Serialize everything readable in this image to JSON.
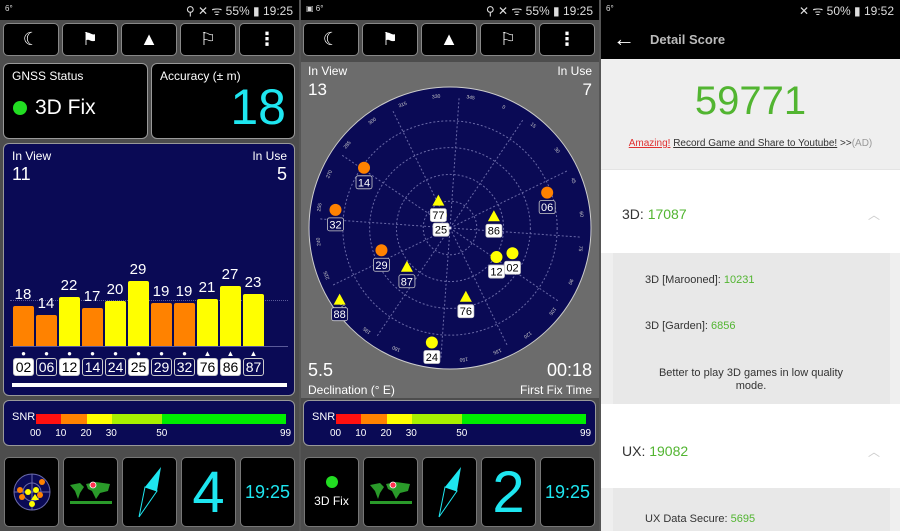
{
  "colors": {
    "navy": "#0a0a55",
    "orange": "#ff8200",
    "yellow": "#ffff00",
    "cyan": "#1ee6f0",
    "green_score": "#52b531",
    "fix_green": "#22dd22"
  },
  "toolbar": {
    "icons": [
      "moon-icon",
      "person-flag-icon",
      "navigation-arrow-icon",
      "flags-icon",
      "more-vert-icon"
    ],
    "glyphs": [
      "☾",
      "⚑",
      "▲",
      "⚐",
      "⋮"
    ]
  },
  "snr_legend": {
    "label": "SNR",
    "ticks": [
      "00",
      "10",
      "20",
      "30",
      "50",
      "99"
    ],
    "segments": [
      {
        "from": 0,
        "to": 10,
        "color": "#ff1010"
      },
      {
        "from": 10,
        "to": 20,
        "color": "#ff8200"
      },
      {
        "from": 20,
        "to": 30,
        "color": "#ffff00"
      },
      {
        "from": 30,
        "to": 50,
        "color": "#a8f000"
      },
      {
        "from": 50,
        "to": 99,
        "color": "#00ee00"
      }
    ]
  },
  "panel1": {
    "status": {
      "left": "6°",
      "right": "⚲ ✕ ᯤ 55% ▮ 19:25"
    },
    "gnss": {
      "title": "GNSS Status",
      "value": "3D Fix"
    },
    "accuracy": {
      "title": "Accuracy (± m)",
      "value": "18"
    },
    "signal": {
      "in_view_label": "In View",
      "in_view": "11",
      "in_use_label": "In Use",
      "in_use": "5",
      "satellites": [
        {
          "prn": "02",
          "snr": 18,
          "used": true,
          "marker": "circle"
        },
        {
          "prn": "06",
          "snr": 14,
          "used": false,
          "marker": "circle"
        },
        {
          "prn": "12",
          "snr": 22,
          "used": true,
          "marker": "circle"
        },
        {
          "prn": "14",
          "snr": 17,
          "used": false,
          "marker": "circle"
        },
        {
          "prn": "24",
          "snr": 20,
          "used": false,
          "marker": "circle"
        },
        {
          "prn": "25",
          "snr": 29,
          "used": true,
          "marker": "circle"
        },
        {
          "prn": "29",
          "snr": 19,
          "used": false,
          "marker": "circle"
        },
        {
          "prn": "32",
          "snr": 19,
          "used": false,
          "marker": "circle"
        },
        {
          "prn": "76",
          "snr": 21,
          "used": true,
          "marker": "triangle"
        },
        {
          "prn": "86",
          "snr": 27,
          "used": true,
          "marker": "triangle"
        },
        {
          "prn": "87",
          "snr": 23,
          "used": false,
          "marker": "triangle"
        }
      ]
    },
    "tiles": {
      "count": "4",
      "time": "19:25"
    }
  },
  "panel2": {
    "status": {
      "left": "▣ 6°",
      "right": "⚲ ✕ ᯤ 55% ▮ 19:25"
    },
    "sky": {
      "in_view_label": "In View",
      "in_view": "13",
      "in_use_label": "In Use",
      "in_use": "7",
      "declination": "5.5",
      "declination_label": "Declination (° E)",
      "fix_time": "00:18",
      "fix_time_label": "First Fix Time",
      "azimuth_labels": [
        "0",
        "15",
        "30",
        "45",
        "60",
        "75",
        "90",
        "105",
        "120",
        "135",
        "150",
        "165",
        "180",
        "195",
        "210",
        "225",
        "240",
        "255",
        "270",
        "285",
        "300",
        "315",
        "330",
        "345"
      ],
      "satellites": [
        {
          "prn": "14",
          "az": 305,
          "el": 23,
          "used": false,
          "marker": "circle"
        },
        {
          "prn": "32",
          "az": 279,
          "el": 16,
          "used": false,
          "marker": "circle"
        },
        {
          "prn": "29",
          "az": 252,
          "el": 44,
          "used": false,
          "marker": "circle"
        },
        {
          "prn": "87",
          "az": 228,
          "el": 53,
          "used": false,
          "marker": "triangle"
        },
        {
          "prn": "88",
          "az": 237,
          "el": 6,
          "used": false,
          "marker": "triangle"
        },
        {
          "prn": "24",
          "az": 189,
          "el": 16,
          "used": true,
          "marker": "circle"
        },
        {
          "prn": "25",
          "az": 325,
          "el": 80,
          "used": true,
          "marker": "circle"
        },
        {
          "prn": "77",
          "az": 337,
          "el": 71,
          "used": true,
          "marker": "triangle"
        },
        {
          "prn": "86",
          "az": 75,
          "el": 61,
          "used": true,
          "marker": "triangle"
        },
        {
          "prn": "06",
          "az": 70,
          "el": 24,
          "used": false,
          "marker": "circle"
        },
        {
          "prn": "12",
          "az": 122,
          "el": 55,
          "used": true,
          "marker": "circle"
        },
        {
          "prn": "02",
          "az": 112,
          "el": 47,
          "used": true,
          "marker": "circle"
        },
        {
          "prn": "76",
          "az": 167,
          "el": 45,
          "used": true,
          "marker": "triangle"
        }
      ]
    },
    "tiles": {
      "fix": "3D Fix",
      "count": "2",
      "time": "19:25"
    }
  },
  "panel3": {
    "status": {
      "left": "6°",
      "right": "✕ ᯤ 50% ▮ 19:52"
    },
    "header": {
      "title": "Detail Score"
    },
    "total": "59771",
    "ad": {
      "highlight": "Amazing!",
      "text": "Record Game and Share to Youtube!",
      "suffix": ">>",
      "tag": "(AD)"
    },
    "sections": [
      {
        "label": "3D:",
        "score": "17087",
        "items": [
          {
            "label": "3D [Marooned]:",
            "score": "10231"
          },
          {
            "label": "3D [Garden]:",
            "score": "6856"
          }
        ],
        "note": "Better to play 3D games in low quality mode."
      },
      {
        "label": "UX:",
        "score": "19082",
        "items": [
          {
            "label": "UX Data Secure:",
            "score": "5695"
          }
        ]
      }
    ]
  }
}
